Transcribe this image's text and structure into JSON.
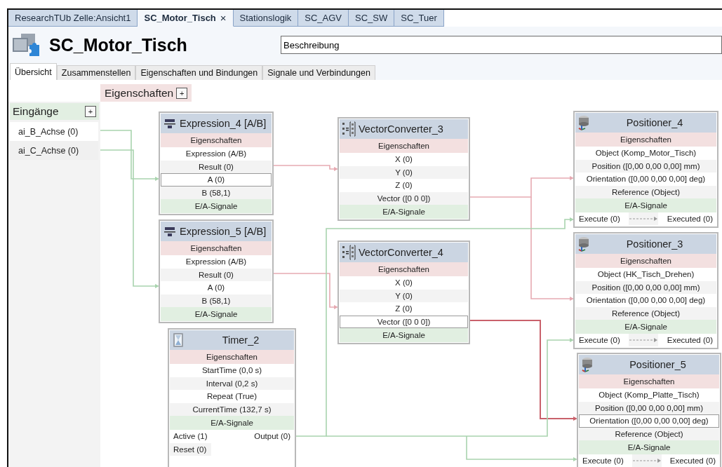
{
  "document_tabs": [
    {
      "label": "ResearchTUb Zelle:Ansicht1",
      "selected": false
    },
    {
      "label": "SC_Motor_Tisch",
      "selected": true,
      "close": "×"
    },
    {
      "label": "Stationslogik",
      "selected": false
    },
    {
      "label": "SC_AGV",
      "selected": false
    },
    {
      "label": "SC_SW",
      "selected": false
    },
    {
      "label": "SC_Tuer",
      "selected": false
    }
  ],
  "header": {
    "title": "SC_Motor_Tisch",
    "description": "Beschreibung"
  },
  "view_tabs": [
    {
      "label": "Übersicht",
      "selected": true
    },
    {
      "label": "Zusammenstellen",
      "selected": false
    },
    {
      "label": "Eigenschaften und Bindungen",
      "selected": false
    },
    {
      "label": "Signale und Verbindungen",
      "selected": false
    }
  ],
  "canvas": {
    "properties_header": {
      "label": "Eigenschaften",
      "expand": "+"
    },
    "inputs": {
      "label": "Eingänge",
      "expand": "+",
      "items": [
        {
          "label": "ai_B_Achse (0)"
        },
        {
          "label": "ai_C_Achse (0)"
        }
      ]
    },
    "nodes": [
      {
        "kind": "expression",
        "title": "Expression_4 [A/B]",
        "properties_label": "Eigenschaften",
        "properties": [
          {
            "label": "Expression (A/B)",
            "selected": false
          },
          {
            "label": "Result (0)",
            "selected": false
          },
          {
            "label": "A (0)",
            "selected": true
          },
          {
            "label": "B (58,1)",
            "selected": false
          }
        ],
        "signals_label": "E/A-Signale"
      },
      {
        "kind": "expression",
        "title": "Expression_5 [A/B]",
        "properties_label": "Eigenschaften",
        "properties": [
          {
            "label": "Expression (A/B)",
            "selected": false
          },
          {
            "label": "Result (0)",
            "selected": false
          },
          {
            "label": "A (0)",
            "selected": false
          },
          {
            "label": "B (58,1)",
            "selected": false
          }
        ],
        "signals_label": "E/A-Signale"
      },
      {
        "kind": "timer",
        "title": "Timer_2",
        "properties_label": "Eigenschaften",
        "properties": [
          {
            "label": "StartTime (0,0 s)",
            "selected": false
          },
          {
            "label": "Interval (0,2 s)",
            "selected": false
          },
          {
            "label": "Repeat (True)",
            "selected": false
          },
          {
            "label": "CurrentTime (132,7 s)",
            "selected": false
          }
        ],
        "signals_label": "E/A-Signale",
        "signal_inputs": [
          "Active (1)",
          "Reset (0)"
        ],
        "signal_outputs": [
          "Output (0)"
        ]
      },
      {
        "kind": "vector",
        "title": "VectorConverter_3",
        "properties_label": "Eigenschaften",
        "properties": [
          {
            "label": "X (0)",
            "selected": false
          },
          {
            "label": "Y (0)",
            "selected": false
          },
          {
            "label": "Z (0)",
            "selected": false
          },
          {
            "label": "Vector ([0 0 0])",
            "selected": false
          }
        ],
        "signals_label": "E/A-Signale"
      },
      {
        "kind": "vector",
        "title": "VectorConverter_4",
        "properties_label": "Eigenschaften",
        "properties": [
          {
            "label": "X (0)",
            "selected": false
          },
          {
            "label": "Y (0)",
            "selected": false
          },
          {
            "label": "Z (0)",
            "selected": false
          },
          {
            "label": "Vector ([0 0 0])",
            "selected": true
          }
        ],
        "signals_label": "E/A-Signale"
      },
      {
        "kind": "positioner",
        "title": "Positioner_4",
        "properties_label": "Eigenschaften",
        "properties": [
          {
            "label": "Object (Komp_Motor_Tisch)",
            "selected": false
          },
          {
            "label": "Position ([0,00 0,00 0,00] mm)",
            "selected": false
          },
          {
            "label": "Orientation ([0,00 0,00 0,00] deg)",
            "selected": false
          },
          {
            "label": "Reference (Object)",
            "selected": false
          }
        ],
        "signals_label": "E/A-Signale",
        "signal_inputs": [
          "Execute (0)"
        ],
        "signal_outputs": [
          "Executed (0)"
        ]
      },
      {
        "kind": "positioner",
        "title": "Positioner_3",
        "properties_label": "Eigenschaften",
        "properties": [
          {
            "label": "Object (HK_Tisch_Drehen)",
            "selected": false
          },
          {
            "label": "Position ([0,00 0,00 0,00] mm)",
            "selected": false
          },
          {
            "label": "Orientation ([0,00 0,00 0,00] deg)",
            "selected": false
          },
          {
            "label": "Reference (Object)",
            "selected": false
          }
        ],
        "signals_label": "E/A-Signale",
        "signal_inputs": [
          "Execute (0)"
        ],
        "signal_outputs": [
          "Executed (0)"
        ]
      },
      {
        "kind": "positioner",
        "title": "Positioner_5",
        "properties_label": "Eigenschaften",
        "properties": [
          {
            "label": "Object (Komp_Platte_Tisch)",
            "selected": false
          },
          {
            "label": "Position ([0,00 0,00 0,00] mm)",
            "selected": false
          },
          {
            "label": "Orientation ([0,00 0,00 0,00] deg)",
            "selected": true
          },
          {
            "label": "Reference (Object)",
            "selected": false
          }
        ],
        "signals_label": "E/A-Signale",
        "signal_inputs": [
          "Execute (0)"
        ],
        "signal_outputs": [
          "Executed (0)"
        ]
      }
    ]
  }
}
